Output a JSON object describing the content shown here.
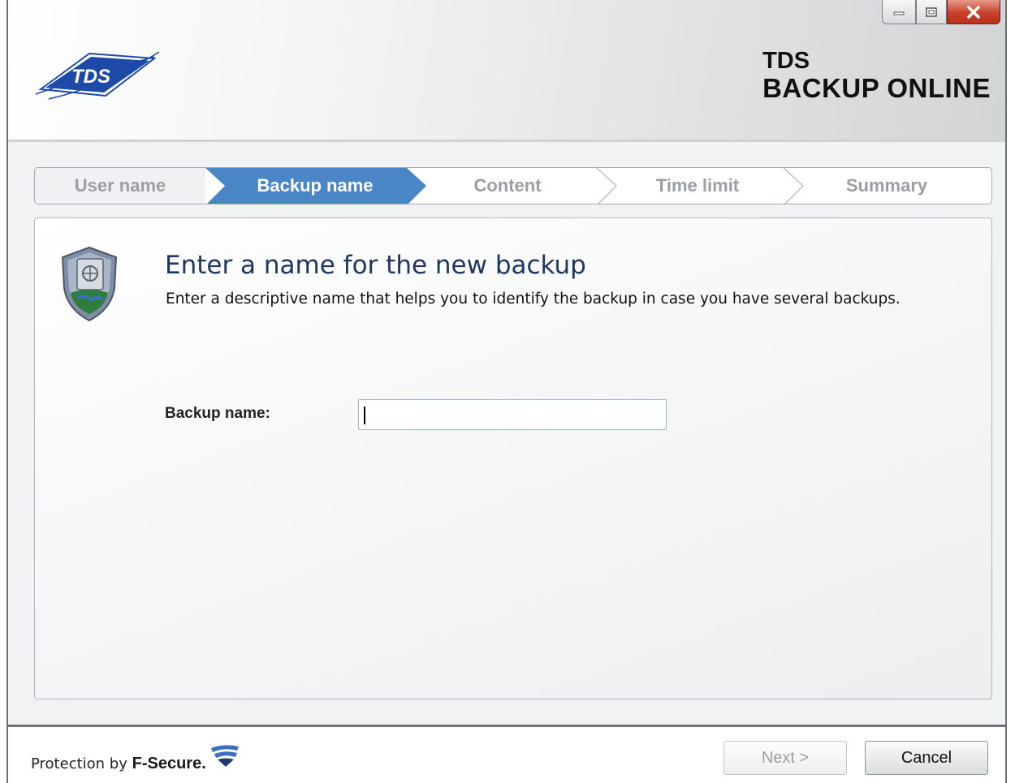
{
  "app": {
    "brand_line1": "TDS",
    "brand_line2": "BACKUP ONLINE",
    "logo_text": "TDS"
  },
  "window_controls": [
    "minimize",
    "maximize",
    "close"
  ],
  "steps": [
    {
      "label": "User name",
      "state": "done"
    },
    {
      "label": "Backup name",
      "state": "active"
    },
    {
      "label": "Content",
      "state": "pending"
    },
    {
      "label": "Time limit",
      "state": "pending"
    },
    {
      "label": "Summary",
      "state": "pending"
    }
  ],
  "content": {
    "heading": "Enter a name for the new backup",
    "description": "Enter a descriptive name that helps you to identify the backup in case you have several backups.",
    "field_label": "Backup name:",
    "field_value": ""
  },
  "footer": {
    "protection_prefix": "Protection by",
    "protection_brand": "F-Secure.",
    "next_label": "Next >",
    "cancel_label": "Cancel"
  },
  "colors": {
    "active_step": "#4a86c5",
    "heading": "#1f3760",
    "tds_blue": "#1d4aa6"
  }
}
